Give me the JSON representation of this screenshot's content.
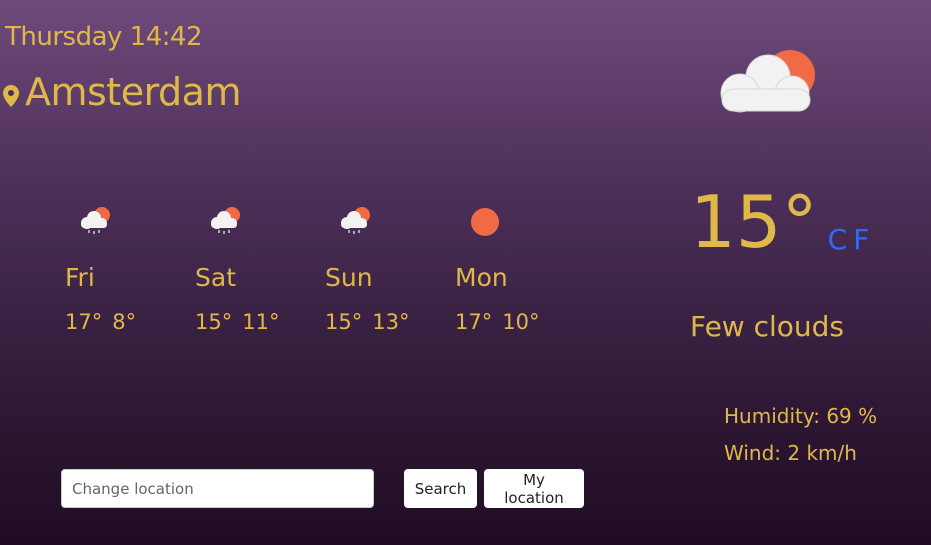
{
  "header": {
    "datetime": "Thursday 14:42",
    "city": "Amsterdam",
    "location_icon": "map-pin-icon"
  },
  "current": {
    "icon": "few-clouds-icon",
    "temperature": "15°",
    "unit_c": "C",
    "unit_f": "F",
    "description": "Few clouds",
    "humidity": "Humidity: 69 %",
    "wind": "Wind: 2 km/h"
  },
  "forecast": [
    {
      "day": "Fri",
      "max": "17°",
      "min": "8°",
      "icon": "rain-cloud-icon"
    },
    {
      "day": "Sat",
      "max": "15°",
      "min": "11°",
      "icon": "rain-cloud-icon"
    },
    {
      "day": "Sun",
      "max": "15°",
      "min": "13°",
      "icon": "rain-cloud-icon"
    },
    {
      "day": "Mon",
      "max": "17°",
      "min": "10°",
      "icon": "sun-icon"
    }
  ],
  "search": {
    "placeholder": "Change location",
    "value": "",
    "search_label": "Search",
    "my_location_label": "My location"
  },
  "colors": {
    "text": "#e0b84a",
    "unit_link": "#2c6bff",
    "sun": "#f06a44",
    "cloud": "#f2f2f2"
  }
}
